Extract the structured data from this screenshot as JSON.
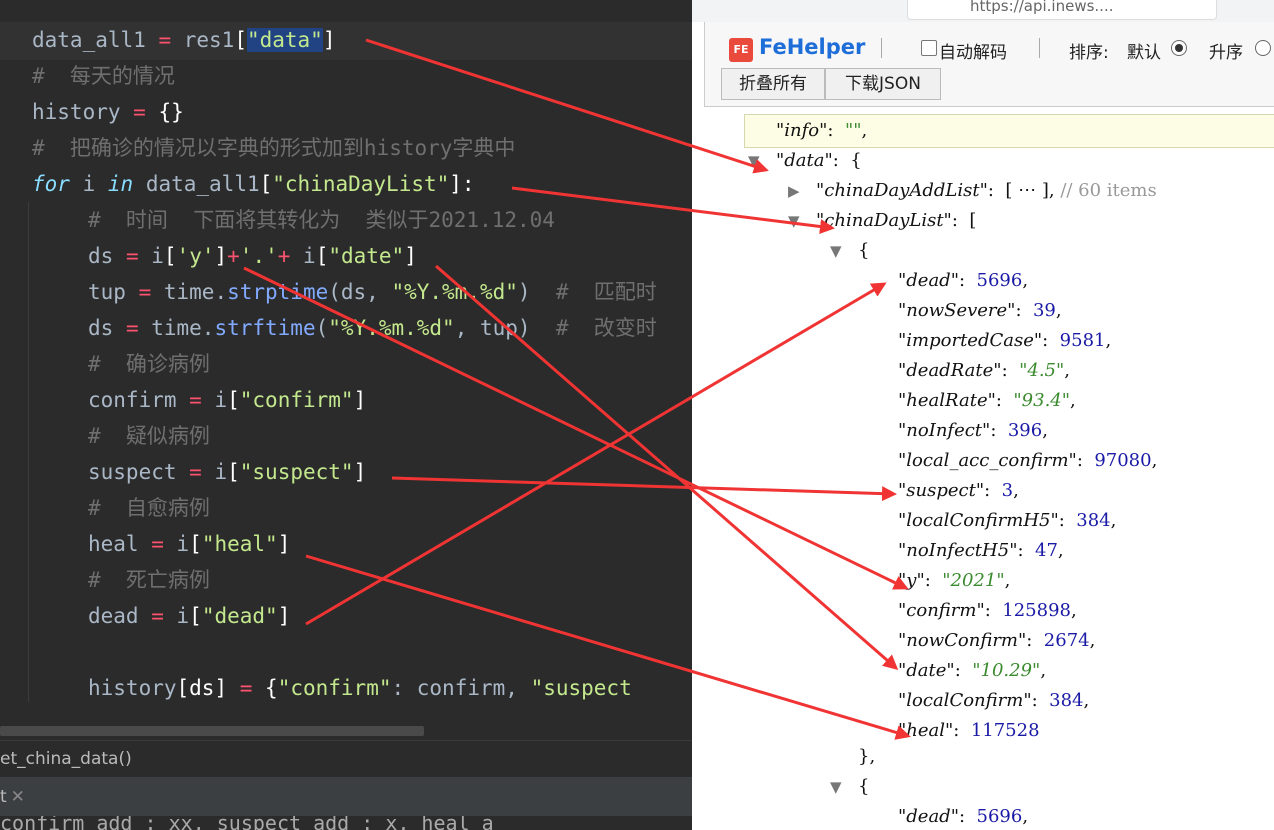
{
  "editor": {
    "code_lines": [
      [
        [
          "data_all1",
          "t-d"
        ],
        [
          " = ",
          "t-o"
        ],
        [
          "res1",
          "t-d"
        ],
        [
          "[",
          "t-v"
        ],
        [
          "\"data\"",
          "t-s"
        ],
        [
          "]",
          "t-v"
        ]
      ],
      [
        [
          "#  每天的情况",
          "t-c"
        ]
      ],
      [
        [
          "history",
          "t-d"
        ],
        [
          " = ",
          "t-o"
        ],
        [
          "{}",
          "t-v"
        ]
      ],
      [
        [
          "#  把确诊的情况以字典的形式加到history字典中",
          "t-c"
        ]
      ],
      [
        [
          "for",
          "t-k"
        ],
        [
          " i ",
          "t-d"
        ],
        [
          "in",
          "t-k"
        ],
        [
          " data_all1",
          "t-d"
        ],
        [
          "[",
          "t-v"
        ],
        [
          "\"chinaDayList\"",
          "t-s"
        ],
        [
          "]:",
          "t-v"
        ]
      ],
      [
        [
          "#  时间  下面将其转化为  类似于2021.12.04",
          "t-c"
        ]
      ],
      [
        [
          "ds",
          "t-d"
        ],
        [
          " = ",
          "t-o"
        ],
        [
          "i",
          "t-d"
        ],
        [
          "[",
          "t-v"
        ],
        [
          "'y'",
          "t-s"
        ],
        [
          "]",
          "t-v"
        ],
        [
          "+",
          "t-o"
        ],
        [
          "'.'",
          "t-s"
        ],
        [
          "+",
          "t-o"
        ],
        [
          " i",
          "t-d"
        ],
        [
          "[",
          "t-v"
        ],
        [
          "\"date\"",
          "t-s"
        ],
        [
          "]",
          "t-v"
        ]
      ],
      [
        [
          "tup",
          "t-d"
        ],
        [
          " = ",
          "t-o"
        ],
        [
          "time.",
          "t-d"
        ],
        [
          "strptime",
          "t-f"
        ],
        [
          "(ds, ",
          "t-d"
        ],
        [
          "\"%Y.%m.%d\"",
          "t-s"
        ],
        [
          ")  ",
          "t-d"
        ],
        [
          "#  匹配时",
          "t-c"
        ]
      ],
      [
        [
          "ds",
          "t-d"
        ],
        [
          " = ",
          "t-o"
        ],
        [
          "time.",
          "t-d"
        ],
        [
          "strftime",
          "t-f"
        ],
        [
          "(",
          "t-d"
        ],
        [
          "\"%Y.%m.%d\"",
          "t-s"
        ],
        [
          ", tup)  ",
          "t-d"
        ],
        [
          "#  改变时",
          "t-c"
        ]
      ],
      [
        [
          "#  确诊病例",
          "t-c"
        ]
      ],
      [
        [
          "confirm",
          "t-d"
        ],
        [
          " = ",
          "t-o"
        ],
        [
          "i",
          "t-d"
        ],
        [
          "[",
          "t-v"
        ],
        [
          "\"confirm\"",
          "t-s"
        ],
        [
          "]",
          "t-v"
        ]
      ],
      [
        [
          "#  疑似病例",
          "t-c"
        ]
      ],
      [
        [
          "suspect",
          "t-d"
        ],
        [
          " = ",
          "t-o"
        ],
        [
          "i",
          "t-d"
        ],
        [
          "[",
          "t-v"
        ],
        [
          "\"suspect\"",
          "t-s"
        ],
        [
          "]",
          "t-v"
        ]
      ],
      [
        [
          "#  自愈病例",
          "t-c"
        ]
      ],
      [
        [
          "heal",
          "t-d"
        ],
        [
          " = ",
          "t-o"
        ],
        [
          "i",
          "t-d"
        ],
        [
          "[",
          "t-v"
        ],
        [
          "\"heal\"",
          "t-s"
        ],
        [
          "]",
          "t-v"
        ]
      ],
      [
        [
          "#  死亡病例",
          "t-c"
        ]
      ],
      [
        [
          "dead",
          "t-d"
        ],
        [
          " = ",
          "t-o"
        ],
        [
          "i",
          "t-d"
        ],
        [
          "[",
          "t-v"
        ],
        [
          "\"dead\"",
          "t-s"
        ],
        [
          "]",
          "t-v"
        ]
      ],
      [],
      [
        [
          "history",
          "t-d"
        ],
        [
          "[ds]",
          "t-v"
        ],
        [
          " = ",
          "t-o"
        ],
        [
          "{",
          "t-v"
        ],
        [
          "\"confirm\"",
          "t-s"
        ],
        [
          ": confirm, ",
          "t-d"
        ],
        [
          "\"suspect",
          "t-s"
        ]
      ]
    ],
    "breadcrumb": "et_china_data()",
    "run_tab": "t",
    "bottom_line": "  confirm_add : xx, suspect_add : x, heal_a"
  },
  "browser": {
    "url": "https://api.inews...."
  },
  "fehelper": {
    "logo_text": "FE",
    "title": "FeHelper",
    "auto_decode_label": "自动解码",
    "sort_label": "排序:",
    "sort_default": "默认",
    "sort_asc": "升序",
    "collapse_all": "折叠所有",
    "download_json": "下载JSON"
  },
  "json_view": {
    "lines": [
      [
        [
          "\"info\"",
          "jk"
        ],
        [
          ":  ",
          "jp"
        ],
        [
          "\"\"",
          "js"
        ],
        [
          ",",
          "jp"
        ]
      ],
      [
        [
          "\"data\"",
          "jk"
        ],
        [
          ":  {",
          "jp"
        ]
      ],
      [
        [
          "\"chinaDayAddList\"",
          "jk"
        ],
        [
          ":  [ ⋯ ],",
          "jp"
        ],
        [
          " // 60 items",
          "jc"
        ]
      ],
      [
        [
          "\"chinaDayList\"",
          "jk"
        ],
        [
          ":  [",
          "jp"
        ]
      ],
      [
        [
          "{",
          "jp"
        ]
      ],
      [
        [
          "\"dead\"",
          "jk"
        ],
        [
          ":  ",
          "jp"
        ],
        [
          "5696",
          "jn"
        ],
        [
          ",",
          "jp"
        ]
      ],
      [
        [
          "\"nowSevere\"",
          "jk"
        ],
        [
          ":  ",
          "jp"
        ],
        [
          "39",
          "jn"
        ],
        [
          ",",
          "jp"
        ]
      ],
      [
        [
          "\"importedCase\"",
          "jk"
        ],
        [
          ":  ",
          "jp"
        ],
        [
          "9581",
          "jn"
        ],
        [
          ",",
          "jp"
        ]
      ],
      [
        [
          "\"deadRate\"",
          "jk"
        ],
        [
          ":  ",
          "jp"
        ],
        [
          "\"4.5\"",
          "js"
        ],
        [
          ",",
          "jp"
        ]
      ],
      [
        [
          "\"healRate\"",
          "jk"
        ],
        [
          ":  ",
          "jp"
        ],
        [
          "\"93.4\"",
          "js"
        ],
        [
          ",",
          "jp"
        ]
      ],
      [
        [
          "\"noInfect\"",
          "jk"
        ],
        [
          ":  ",
          "jp"
        ],
        [
          "396",
          "jn"
        ],
        [
          ",",
          "jp"
        ]
      ],
      [
        [
          "\"local_acc_confirm\"",
          "jk"
        ],
        [
          ":  ",
          "jp"
        ],
        [
          "97080",
          "jn"
        ],
        [
          ",",
          "jp"
        ]
      ],
      [
        [
          "\"suspect\"",
          "jk"
        ],
        [
          ":  ",
          "jp"
        ],
        [
          "3",
          "jn"
        ],
        [
          ",",
          "jp"
        ]
      ],
      [
        [
          "\"localConfirmH5\"",
          "jk"
        ],
        [
          ":  ",
          "jp"
        ],
        [
          "384",
          "jn"
        ],
        [
          ",",
          "jp"
        ]
      ],
      [
        [
          "\"noInfectH5\"",
          "jk"
        ],
        [
          ":  ",
          "jp"
        ],
        [
          "47",
          "jn"
        ],
        [
          ",",
          "jp"
        ]
      ],
      [
        [
          "\"y\"",
          "jk"
        ],
        [
          ":  ",
          "jp"
        ],
        [
          "\"2021\"",
          "js"
        ],
        [
          ",",
          "jp"
        ]
      ],
      [
        [
          "\"confirm\"",
          "jk"
        ],
        [
          ":  ",
          "jp"
        ],
        [
          "125898",
          "jn"
        ],
        [
          ",",
          "jp"
        ]
      ],
      [
        [
          "\"nowConfirm\"",
          "jk"
        ],
        [
          ":  ",
          "jp"
        ],
        [
          "2674",
          "jn"
        ],
        [
          ",",
          "jp"
        ]
      ],
      [
        [
          "\"date\"",
          "jk"
        ],
        [
          ":  ",
          "jp"
        ],
        [
          "\"10.29\"",
          "js"
        ],
        [
          ",",
          "jp"
        ]
      ],
      [
        [
          "\"localConfirm\"",
          "jk"
        ],
        [
          ":  ",
          "jp"
        ],
        [
          "384",
          "jn"
        ],
        [
          ",",
          "jp"
        ]
      ],
      [
        [
          "\"heal\"",
          "jk"
        ],
        [
          ":  ",
          "jp"
        ],
        [
          "117528",
          "jn"
        ]
      ],
      [
        [
          "},",
          "jp"
        ]
      ],
      [
        [
          "{",
          "jp"
        ]
      ],
      [
        [
          "\"dead\"",
          "jk"
        ],
        [
          ":  ",
          "jp"
        ],
        [
          "5696",
          "jn"
        ],
        [
          ",",
          "jp"
        ]
      ]
    ]
  },
  "colors": {
    "editor_bg": "#2b2b2b",
    "arrow": "#f03434",
    "fehelper_blue": "#1d6ed8"
  }
}
